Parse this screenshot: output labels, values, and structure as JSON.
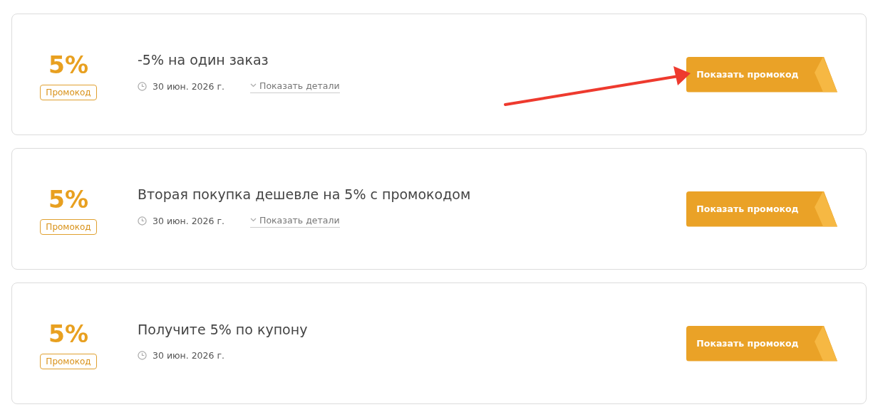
{
  "offers": [
    {
      "discount": "5%",
      "badge": "Промокод",
      "title": "-5% на один заказ",
      "date": "30 июн. 2026 г.",
      "details_link": "Показать детали",
      "button": "Показать промокод",
      "pointed_at": true
    },
    {
      "discount": "5%",
      "badge": "Промокод",
      "title": "Вторая покупка дешевле на 5% с промокодом",
      "date": "30 июн. 2026 г.",
      "details_link": "Показать детали",
      "button": "Показать промокод",
      "pointed_at": false
    },
    {
      "discount": "5%",
      "badge": "Промокод",
      "title": "Получите 5% по купону",
      "date": "30 июн. 2026 г.",
      "button": "Показать промокод",
      "pointed_at": false
    }
  ]
}
